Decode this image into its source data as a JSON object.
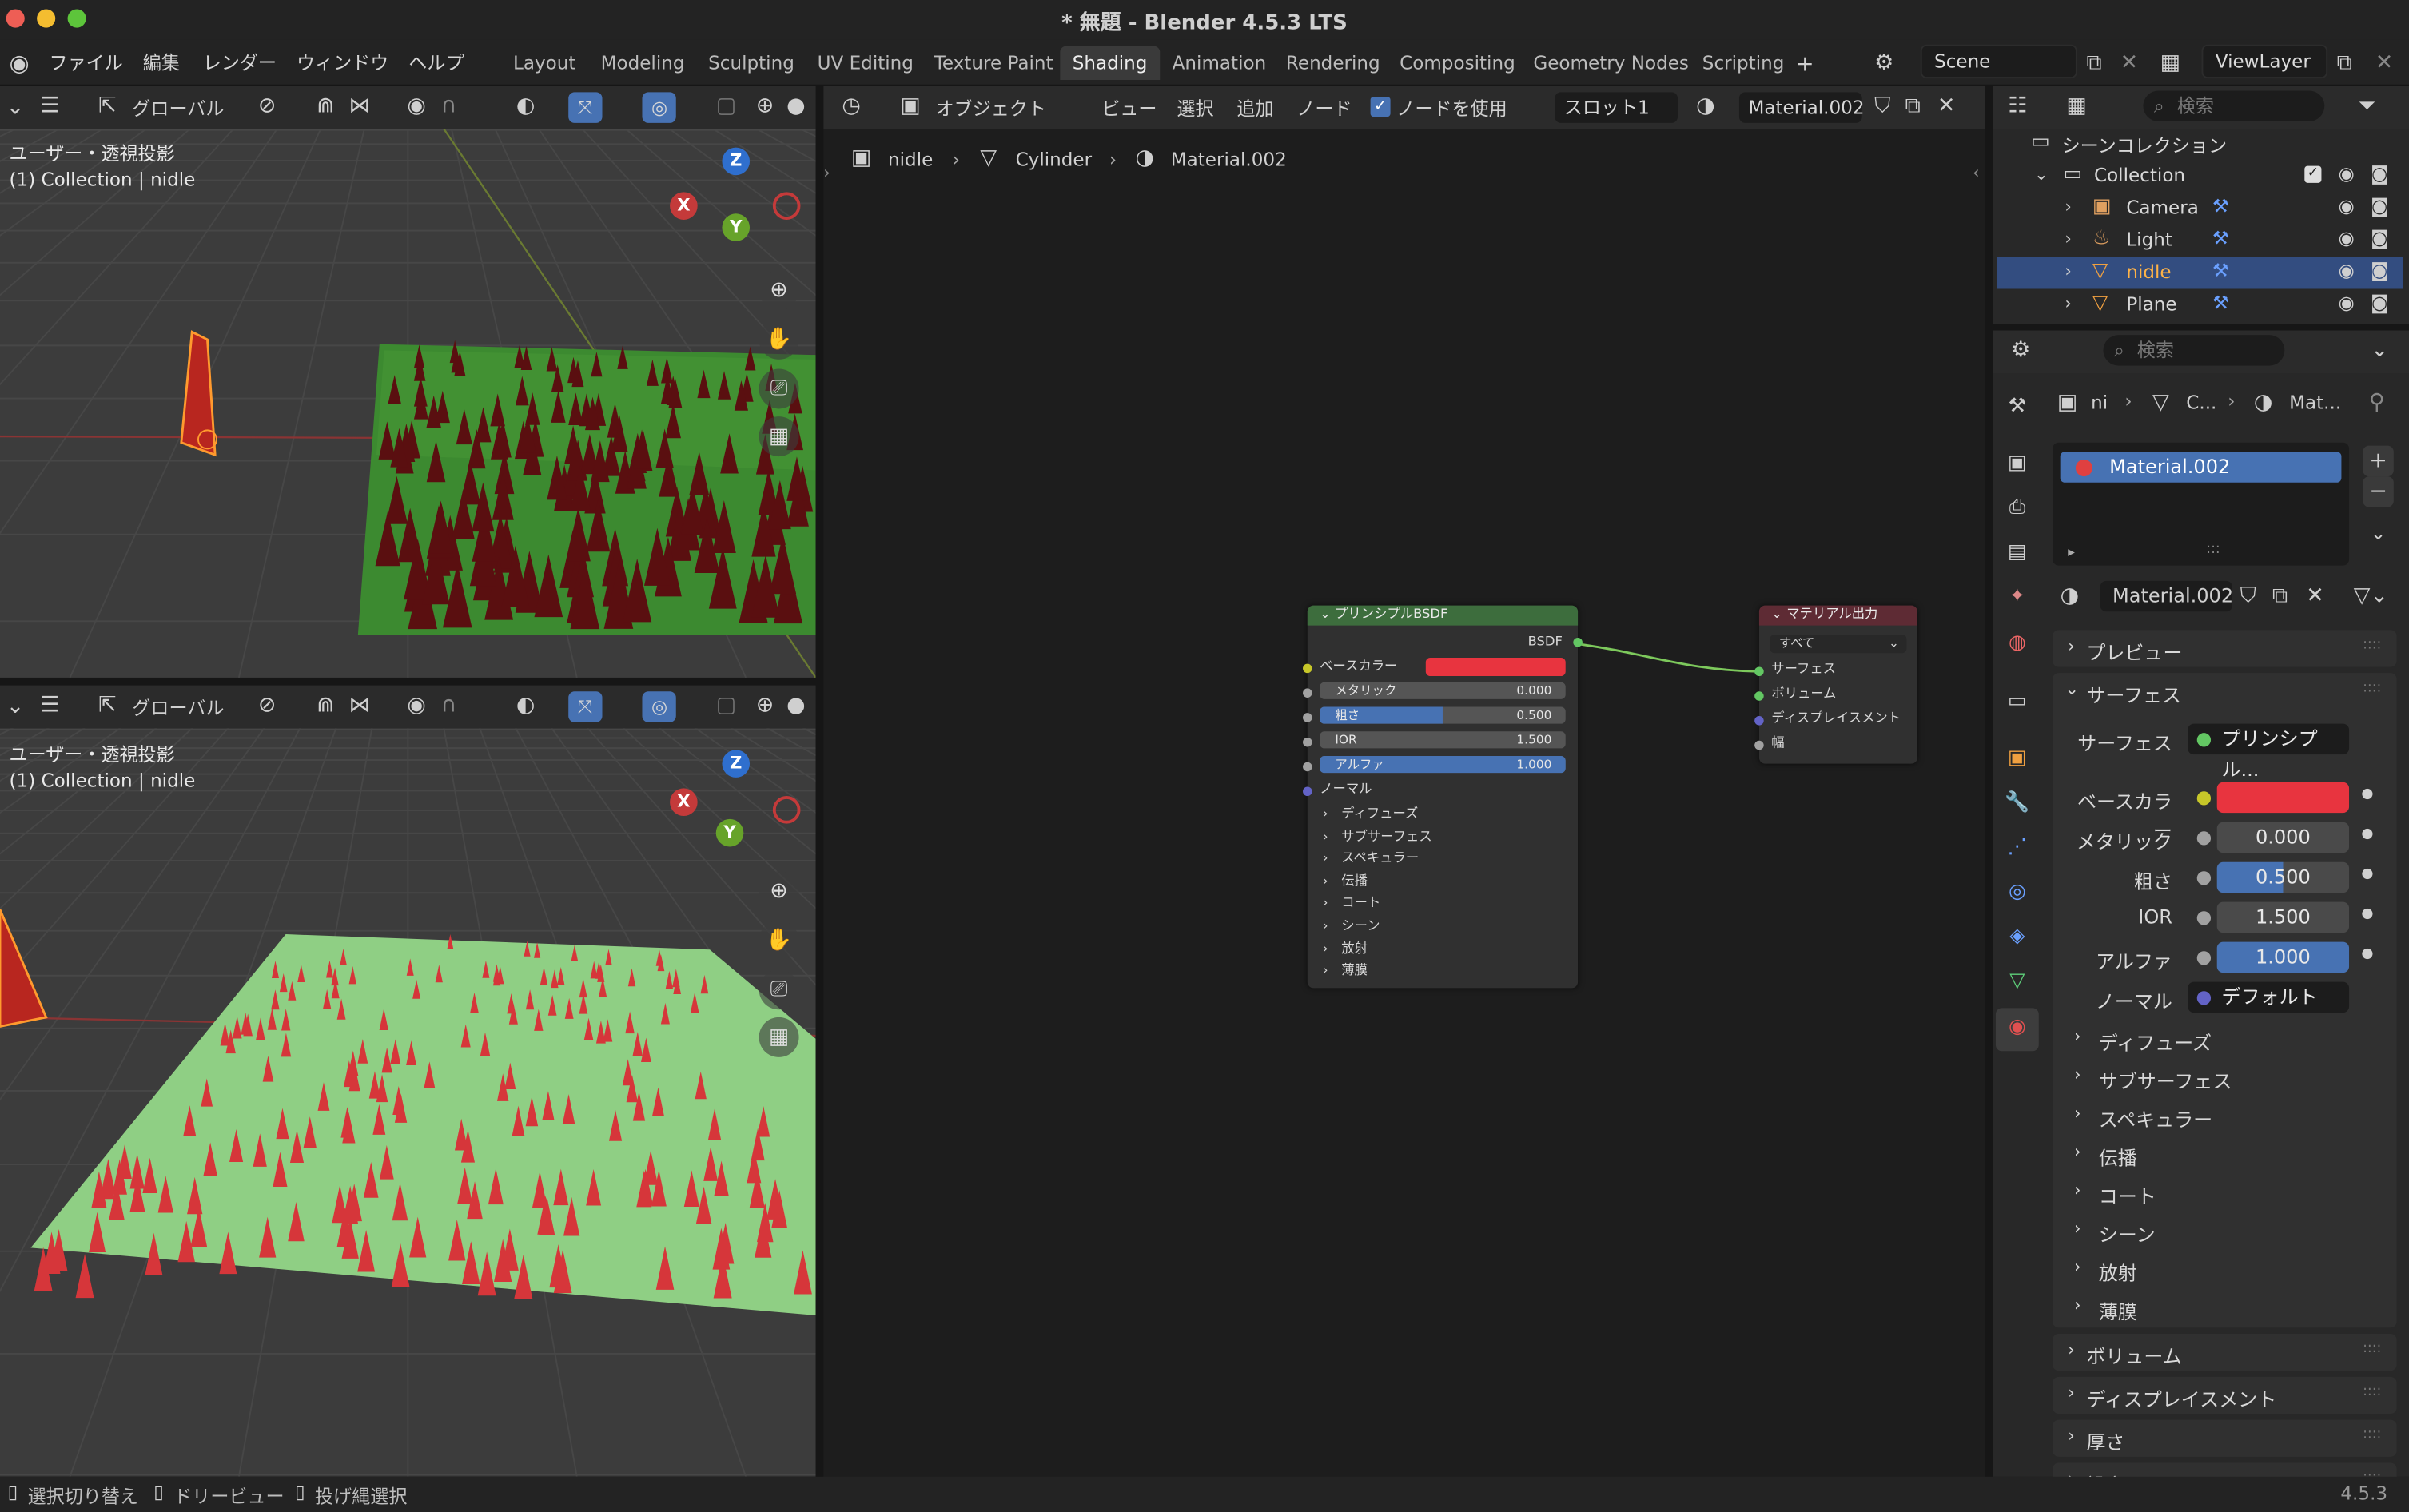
{
  "window": {
    "title": "* 無題 - Blender 4.5.3 LTS"
  },
  "menus": [
    "ファイル",
    "編集",
    "レンダー",
    "ウィンドウ",
    "ヘルプ"
  ],
  "workspaces": [
    "Layout",
    "Modeling",
    "Sculpting",
    "UV Editing",
    "Texture Paint",
    "Shading",
    "Animation",
    "Rendering",
    "Compositing",
    "Geometry Nodes",
    "Scripting"
  ],
  "active_workspace": "Shading",
  "scene": {
    "name": "Scene",
    "viewlayer": "ViewLayer"
  },
  "viewport": {
    "orientation": "グローバル",
    "view_label": "ユーザー・透視投影",
    "collection_label": "(1) Collection | nidle"
  },
  "node_header": {
    "object_mode": "オブジェクト",
    "menu_view": "ビュー",
    "menu_select": "選択",
    "menu_add": "追加",
    "menu_node": "ノード",
    "use_nodes": "ノードを使用",
    "slot": "スロット1",
    "material": "Material.002"
  },
  "breadcrumb": {
    "object": "nidle",
    "mesh": "Cylinder",
    "material": "Material.002"
  },
  "bsdf_node": {
    "title": "プリンシプルBSDF",
    "output": "BSDF",
    "base_color": "ベースカラー",
    "base_color_hex": "#e8343f",
    "metallic_label": "メタリック",
    "metallic": "0.000",
    "roughness_label": "粗さ",
    "roughness": "0.500",
    "roughness_frac": 0.5,
    "ior_label": "IOR",
    "ior": "1.500",
    "alpha_label": "アルファ",
    "alpha": "1.000",
    "alpha_frac": 1.0,
    "normal": "ノーマル",
    "sections": [
      "ディフューズ",
      "サブサーフェス",
      "スペキュラー",
      "伝播",
      "コート",
      "シーン",
      "放射",
      "薄膜"
    ]
  },
  "output_node": {
    "title": "マテリアル出力",
    "target": "すべて",
    "surface": "サーフェス",
    "volume": "ボリューム",
    "displacement": "ディスプレイスメント",
    "thickness": "幅"
  },
  "outliner": {
    "search_placeholder": "検索",
    "root": "シーンコレクション",
    "collection": "Collection",
    "items": [
      {
        "name": "Camera",
        "selected": false
      },
      {
        "name": "Light",
        "selected": false
      },
      {
        "name": "nidle",
        "selected": true
      },
      {
        "name": "Plane",
        "selected": false
      }
    ]
  },
  "properties": {
    "search_placeholder": "検索",
    "crumbs": [
      "ni",
      "C...",
      "Mat..."
    ],
    "slot_material": "Material.002",
    "datablock": "Material.002",
    "panel_preview": "プレビュー",
    "panel_surface": "サーフェス",
    "surface_label": "サーフェス",
    "surface_value": "プリンシプル...",
    "base_color_label": "ベースカラー",
    "metallic_label": "メタリック",
    "metallic": "0.000",
    "roughness_label": "粗さ",
    "roughness": "0.500",
    "ior_label": "IOR",
    "ior": "1.500",
    "alpha_label": "アルファ",
    "alpha": "1.000",
    "normal_label": "ノーマル",
    "normal_value": "デフォルト",
    "subsections": [
      "ディフューズ",
      "サブサーフェス",
      "スペキュラー",
      "伝播",
      "コート",
      "シーン",
      "放射",
      "薄膜"
    ],
    "panels_bottom": [
      "ボリューム",
      "ディスプレイスメント",
      "厚さ",
      "設定"
    ]
  },
  "statusbar": {
    "hint1": "選択切り替え",
    "hint2": "ドリービュー",
    "hint3": "投げ縄選択",
    "version": "4.5.3"
  },
  "colors": {
    "accent": "#4772b3",
    "selected_row": "#334d80",
    "node_bsdf_header": "#3d6d3d",
    "node_output_header": "#5e2b34",
    "link": "#7dc95c"
  }
}
